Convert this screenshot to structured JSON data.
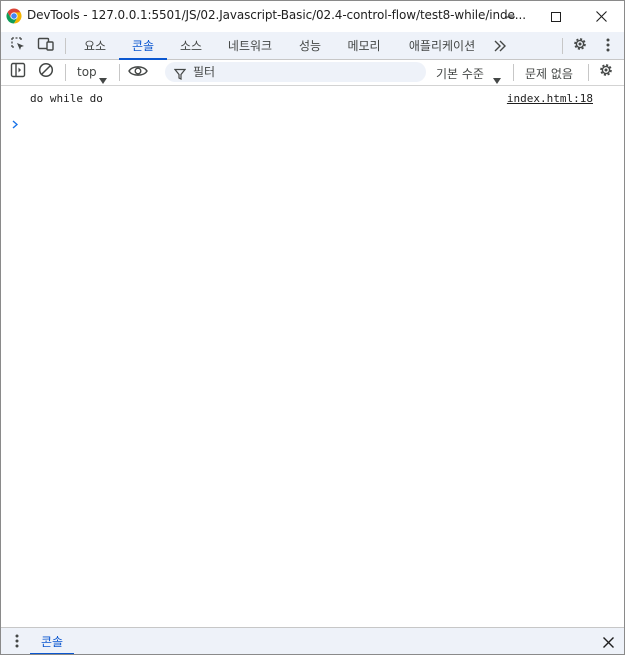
{
  "window": {
    "title": "DevTools - 127.0.0.1:5501/JS/02.Javascript-Basic/02.4-control-flow/test8-while/inde...",
    "app_icon": "chrome-icon",
    "controls": [
      "minimize-icon",
      "maximize-icon",
      "close-icon"
    ]
  },
  "main_toolbar": {
    "icons": [
      "inspect-element-icon",
      "device-toolbar-icon"
    ],
    "tabs": [
      {
        "label": "요소"
      },
      {
        "label": "콘솔",
        "active": true
      },
      {
        "label": "소스"
      },
      {
        "label": "네트워크"
      },
      {
        "label": "성능"
      },
      {
        "label": "메모리"
      },
      {
        "label": "애플리케이션"
      }
    ],
    "more_tabs_icon": "chevron-double-right-icon",
    "right_icons": [
      "settings-gear-icon",
      "more-vertical-icon"
    ]
  },
  "console_toolbar": {
    "sidebar_icon": "show-sidebar-icon",
    "clear_icon": "clear-console-icon",
    "context": "top",
    "eye_icon": "live-expression-eye-icon",
    "filter_placeholder": "필터",
    "level": "기본 수준",
    "issues": "문제 없음",
    "settings_icon": "console-settings-gear-icon"
  },
  "console": {
    "messages": [
      {
        "text": "do while do",
        "source": "index.html:18"
      }
    ],
    "prompt_icon": "chevron-right-icon"
  },
  "drawer": {
    "menu_icon": "more-vertical-icon",
    "tab_label": "콘솔",
    "close_icon": "close-icon"
  },
  "colors": {
    "accent": "#0b57d0",
    "toolbar_bg": "#eef2f9",
    "text": "#1f1f1f",
    "secondary_text": "#444746"
  }
}
